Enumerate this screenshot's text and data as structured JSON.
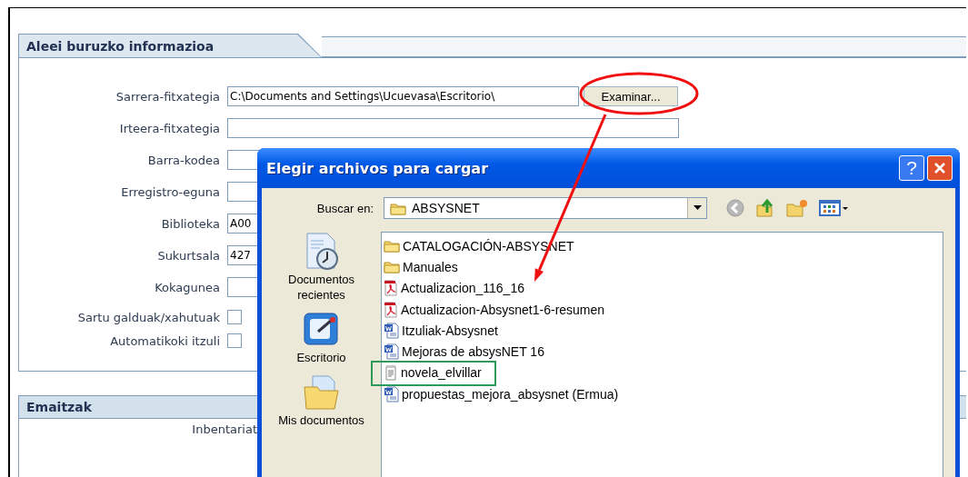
{
  "info_panel": {
    "title": "Aleei buruzko informazioa",
    "fields": [
      {
        "kind": "text",
        "label": "Sarrera-fitxategia",
        "value": "C:\\Documents and Settings\\Ucuevasa\\Escritorio\\",
        "button": "Examinar..."
      },
      {
        "kind": "text",
        "label": "Irteera-fitxategia"
      },
      {
        "kind": "text",
        "label": "Barra-kodea"
      },
      {
        "kind": "text",
        "label": "Erregistro-eguna"
      },
      {
        "kind": "text",
        "label": "Biblioteka",
        "value": "A00"
      },
      {
        "kind": "text",
        "label": "Sukurtsala",
        "value": "427"
      },
      {
        "kind": "text",
        "label": "Kokagunea"
      },
      {
        "kind": "checkbox",
        "label": "Sartu galduak/xahutuak",
        "checked": false
      },
      {
        "kind": "checkbox",
        "label": "Automatikoki itzuli",
        "checked": false
      }
    ]
  },
  "results_panel": {
    "title": "Emaitzak",
    "label": "Inbentariat"
  },
  "dialog": {
    "title": "Elegir archivos para cargar",
    "help_button": "?",
    "look_in_label": "Buscar en:",
    "look_in_value": "ABSYSNET",
    "places": [
      {
        "kind": "recent",
        "label": "Documentos recientes"
      },
      {
        "kind": "desktop",
        "label": "Escritorio"
      },
      {
        "kind": "documents",
        "label": "Mis documentos"
      }
    ],
    "files": [
      {
        "kind": "folder",
        "name": "CATALOGACIÓN-ABSYSNET",
        "marked": false
      },
      {
        "kind": "folder",
        "name": "Manuales",
        "marked": false
      },
      {
        "kind": "pdf",
        "name": "Actualizacion_116_16",
        "marked": false
      },
      {
        "kind": "pdf",
        "name": "Actualizacion-Absysnet1-6-resumen",
        "marked": false
      },
      {
        "kind": "word",
        "name": "Itzuliak-Absysnet",
        "marked": false
      },
      {
        "kind": "word",
        "name": "Mejoras de absysNET 16",
        "marked": false
      },
      {
        "kind": "text",
        "name": "novela_elvillar",
        "marked": true
      },
      {
        "kind": "word",
        "name": "propuestas_mejora_absysnet (Ermua)",
        "marked": false
      }
    ]
  }
}
